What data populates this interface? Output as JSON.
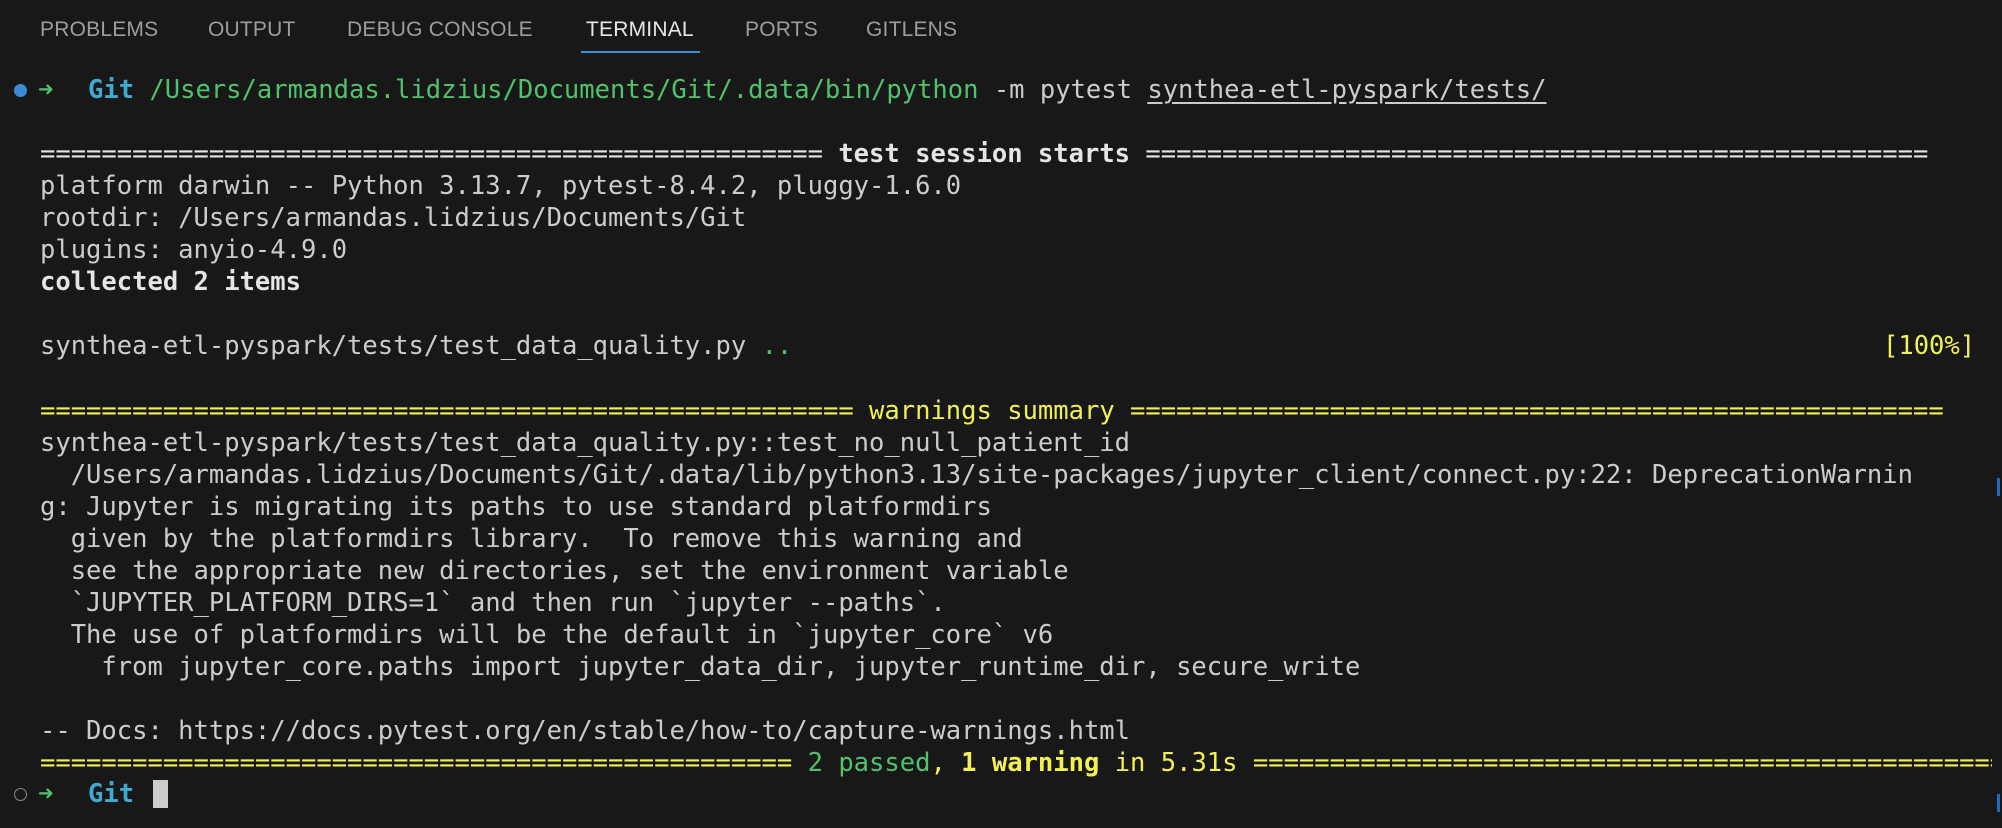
{
  "tabs": [
    {
      "label": "PROBLEMS",
      "active": false
    },
    {
      "label": "OUTPUT",
      "active": false
    },
    {
      "label": "DEBUG CONSOLE",
      "active": false
    },
    {
      "label": "TERMINAL",
      "active": true
    },
    {
      "label": "PORTS",
      "active": false
    },
    {
      "label": "GITLENS",
      "active": false
    }
  ],
  "prompt1": {
    "arrow": "➜",
    "dir": "Git",
    "python": "/Users/armandas.lidzius/Documents/Git/.data/bin/python",
    "args": "-m pytest",
    "path": "synthea-etl-pyspark/tests/"
  },
  "session": {
    "header_left": "=================================================== ",
    "header_title": "test session starts",
    "header_right": " ===================================================",
    "platform": "platform darwin -- Python 3.13.7, pytest-8.4.2, pluggy-1.6.0",
    "rootdir": "rootdir: /Users/armandas.lidzius/Documents/Git",
    "plugins": "plugins: anyio-4.9.0",
    "collected": "collected 2 items",
    "test_file": "synthea-etl-pyspark/tests/test_data_quality.py",
    "test_dots": "..",
    "progress": "[100%]"
  },
  "warnings": {
    "header_left": "===================================================== ",
    "header_title": "warnings summary",
    "header_right": " =====================================================",
    "test_id": "synthea-etl-pyspark/tests/test_data_quality.py::test_no_null_patient_id",
    "line1": "  /Users/armandas.lidzius/Documents/Git/.data/lib/python3.13/site-packages/jupyter_client/connect.py:22: DeprecationWarnin",
    "line2": "g: Jupyter is migrating its paths to use standard platformdirs",
    "line3": "  given by the platformdirs library.  To remove this warning and",
    "line4": "  see the appropriate new directories, set the environment variable",
    "line5": "  `JUPYTER_PLATFORM_DIRS=1` and then run `jupyter --paths`.",
    "line6": "  The use of platformdirs will be the default in `jupyter_core` v6",
    "line7": "    from jupyter_core.paths import jupyter_data_dir, jupyter_runtime_dir, secure_write",
    "docs": "-- Docs: https://docs.pytest.org/en/stable/how-to/capture-warnings.html"
  },
  "summary": {
    "left": "================================================= ",
    "passed": "2 passed",
    "sep": ", ",
    "warning": "1 warning",
    "time": " in 5.31s",
    "right": " ================================================="
  },
  "prompt2": {
    "arrow": "➜",
    "dir": "Git"
  },
  "colors": {
    "background": "#181818",
    "green": "#4ec36b",
    "cyan": "#3faad1",
    "yellow": "#f1f151",
    "tab_accent": "#3f8fd6"
  },
  "icons": [
    "prompt-status-dot-icon",
    "prompt-arrow-icon",
    "cursor-block-icon"
  ]
}
